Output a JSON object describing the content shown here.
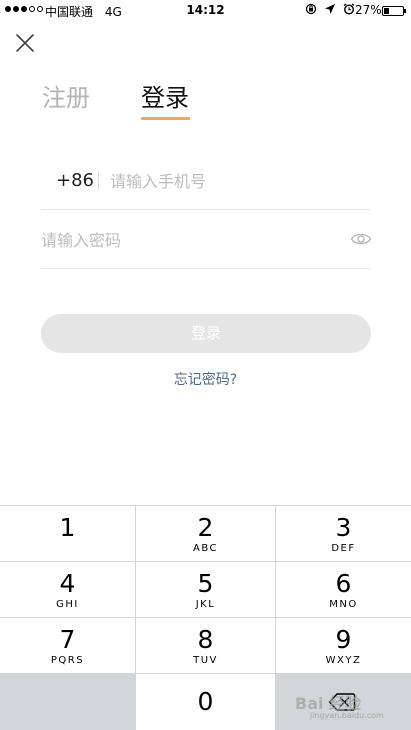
{
  "status_bar": {
    "signal_dots_filled": 3,
    "signal_dots_total": 5,
    "carrier": "中国联通",
    "network": "4G",
    "time": "14:12",
    "battery": "27%",
    "battery_level": 0.27,
    "icons": [
      "orientation-lock-icon",
      "location-arrow-icon",
      "alarm-icon"
    ]
  },
  "close_icon": "close-icon",
  "tabs": [
    {
      "label": "注册",
      "active": false
    },
    {
      "label": "登录",
      "active": true
    }
  ],
  "colors": {
    "accent_underline": "#f2a663",
    "inactive_tab": "#b4b4b4",
    "link": "#4e6a8c",
    "button_disabled": "#e5e5e5",
    "keypad_bg": "#d2d5da"
  },
  "form": {
    "country_code": "+86",
    "phone_placeholder": "请输入手机号",
    "password_placeholder": "请输入密码",
    "eye_icon": "eye-icon",
    "login_button": "登录",
    "forgot_password": "忘记密码?"
  },
  "keypad": {
    "keys": [
      {
        "num": "1",
        "letters": ""
      },
      {
        "num": "2",
        "letters": "ABC"
      },
      {
        "num": "3",
        "letters": "DEF"
      },
      {
        "num": "4",
        "letters": "GHI"
      },
      {
        "num": "5",
        "letters": "JKL"
      },
      {
        "num": "6",
        "letters": "MNO"
      },
      {
        "num": "7",
        "letters": "PQRS"
      },
      {
        "num": "8",
        "letters": "TUV"
      },
      {
        "num": "9",
        "letters": "WXYZ"
      },
      {
        "num": "0",
        "letters": ""
      }
    ],
    "backspace_icon": "backspace-icon"
  },
  "watermark": {
    "text": "Bai 经验",
    "url": "jingyan.baidu.com"
  }
}
